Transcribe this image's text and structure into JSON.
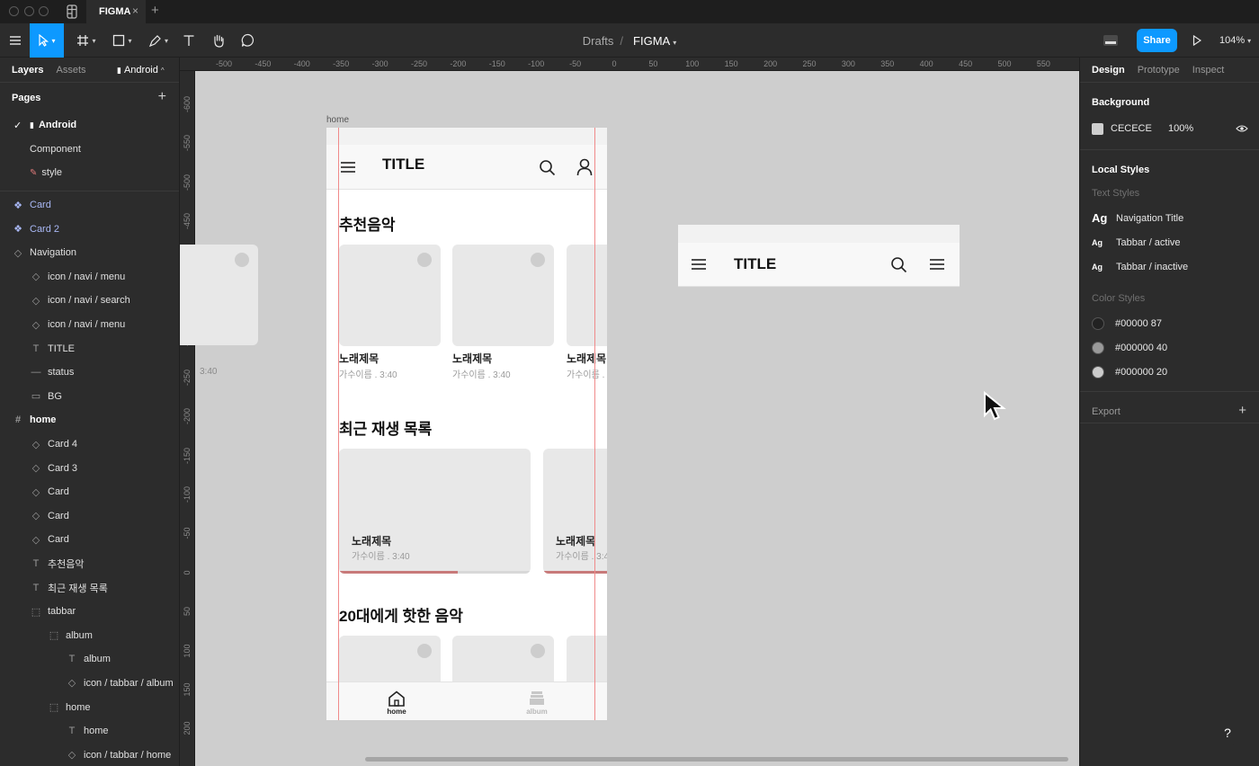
{
  "window": {
    "tab_title": "FIGMA",
    "tab_close": "×",
    "tab_add": "+"
  },
  "toolbar": {
    "breadcrumb_folder": "Drafts",
    "breadcrumb_sep": "/",
    "file_name": "FIGMA",
    "share_label": "Share",
    "zoom_level": "104%",
    "accent_color": "#0d99ff"
  },
  "left_panel": {
    "tabs": [
      "Layers",
      "Assets"
    ],
    "page_selector": "Android",
    "pages_heading": "Pages",
    "add_page": "+",
    "pages": [
      {
        "label": "Android",
        "selected": true
      },
      {
        "label": "Component",
        "selected": false
      },
      {
        "label": "style",
        "selected": false
      }
    ],
    "layers": [
      {
        "label": "Card",
        "kind": "component",
        "indent": 0
      },
      {
        "label": "Card 2",
        "kind": "component",
        "indent": 0
      },
      {
        "label": "Navigation",
        "kind": "instance",
        "indent": 0
      },
      {
        "label": "icon /  navi / menu",
        "kind": "instance",
        "indent": 1
      },
      {
        "label": "icon /  navi / search",
        "kind": "instance",
        "indent": 1
      },
      {
        "label": "icon /  navi / menu",
        "kind": "instance",
        "indent": 1
      },
      {
        "label": "TITLE",
        "kind": "text",
        "indent": 1
      },
      {
        "label": "status",
        "kind": "line",
        "indent": 1
      },
      {
        "label": "BG",
        "kind": "rect",
        "indent": 1
      },
      {
        "label": "home",
        "kind": "frame",
        "indent": 0
      },
      {
        "label": "Card 4",
        "kind": "instance",
        "indent": 1
      },
      {
        "label": "Card 3",
        "kind": "instance",
        "indent": 1
      },
      {
        "label": "Card",
        "kind": "instance",
        "indent": 1
      },
      {
        "label": "Card",
        "kind": "instance",
        "indent": 1
      },
      {
        "label": "Card",
        "kind": "instance",
        "indent": 1
      },
      {
        "label": "추천음악",
        "kind": "text",
        "indent": 1
      },
      {
        "label": "최근 재생 목록",
        "kind": "text",
        "indent": 1
      },
      {
        "label": "tabbar",
        "kind": "group",
        "indent": 1
      },
      {
        "label": "album",
        "kind": "group",
        "indent": 2
      },
      {
        "label": "album",
        "kind": "text",
        "indent": 3
      },
      {
        "label": "icon / tabbar / album",
        "kind": "instance",
        "indent": 3
      },
      {
        "label": "home",
        "kind": "group",
        "indent": 2
      },
      {
        "label": "home",
        "kind": "text",
        "indent": 3
      },
      {
        "label": "icon / tabbar / home",
        "kind": "instance",
        "indent": 3
      }
    ]
  },
  "right_panel": {
    "tabs": [
      "Design",
      "Prototype",
      "Inspect"
    ],
    "background_heading": "Background",
    "background_hex": "CECECE",
    "background_opacity": "100%",
    "local_styles_heading": "Local Styles",
    "text_styles_heading": "Text Styles",
    "text_styles": [
      "Navigation Title",
      "Tabbar / active",
      "Tabbar / inactive"
    ],
    "ag_label": "Ag",
    "color_styles_heading": "Color Styles",
    "color_styles": [
      {
        "label": "#00000 87",
        "color": "#222222"
      },
      {
        "label": "#000000 40",
        "color": "#999999"
      },
      {
        "label": "#000000 20",
        "color": "#cccccc"
      }
    ],
    "export_heading": "Export",
    "export_add": "+"
  },
  "canvas": {
    "ruler_x": [
      "-500",
      "-450",
      "-400",
      "-350",
      "-300",
      "-250",
      "-200",
      "-150",
      "-100",
      "-50",
      "0",
      "50",
      "100",
      "150",
      "200",
      "250",
      "300",
      "350",
      "400",
      "450",
      "500",
      "550"
    ],
    "ruler_y": [
      "-600",
      "-550",
      "-500",
      "-450",
      "-400",
      "-350",
      "-300",
      "-250",
      "-200",
      "-150",
      "-100",
      "-50",
      "0",
      "50",
      "100",
      "150",
      "200"
    ],
    "frame_label": "home",
    "frame": {
      "nav_title": "TITLE",
      "section1": "추천음악",
      "section2": "최근 재생 목록",
      "section3": "20대에게 핫한 음악",
      "song_title": "노래제목",
      "song_sub": "가수이름 . 3:40",
      "song_title_cut": "노래제목",
      "song_sub_cut": "가수이름 .",
      "wide_sub_cut": "가수이름 . 3:4",
      "recent_progress": 0.62,
      "tab_home": "home",
      "tab_album": "album"
    },
    "frame2_title": "TITLE",
    "ghost_time": "3:40"
  },
  "help_label": "?"
}
